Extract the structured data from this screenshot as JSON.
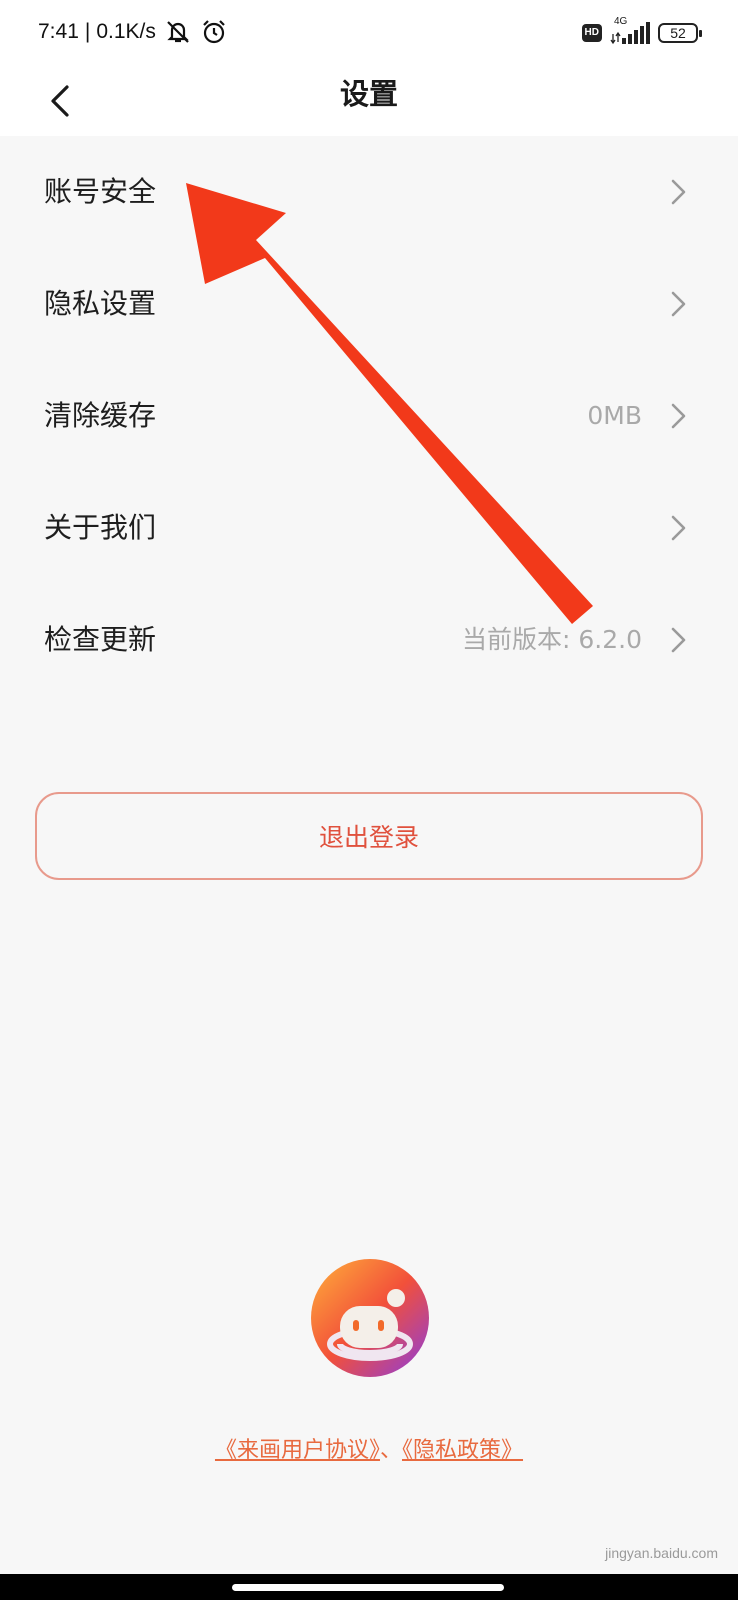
{
  "status_bar": {
    "time": "7:41",
    "separator": "|",
    "speed": "0.1K/s",
    "hd_badge": "HD",
    "network": "4G",
    "battery": "52",
    "icons": [
      "bell-off-icon",
      "alarm-icon",
      "signal-icon",
      "battery-icon"
    ]
  },
  "header": {
    "title": "设置",
    "back_icon": "chevron-left-icon"
  },
  "settings": [
    {
      "label": "账号安全",
      "value": ""
    },
    {
      "label": "隐私设置",
      "value": ""
    },
    {
      "label": "清除缓存",
      "value": "0MB"
    },
    {
      "label": "关于我们",
      "value": ""
    },
    {
      "label": "检查更新",
      "value": "当前版本: 6.2.0"
    }
  ],
  "logout_label": "退出登录",
  "footer": {
    "agreement": "《来画用户协议》",
    "separator": "、",
    "privacy": "《隐私政策》"
  },
  "watermark": "jingyan.baidu.com",
  "colors": {
    "accent": "#e0513d",
    "link": "#e86a3f",
    "annotation": "#f2391a"
  }
}
